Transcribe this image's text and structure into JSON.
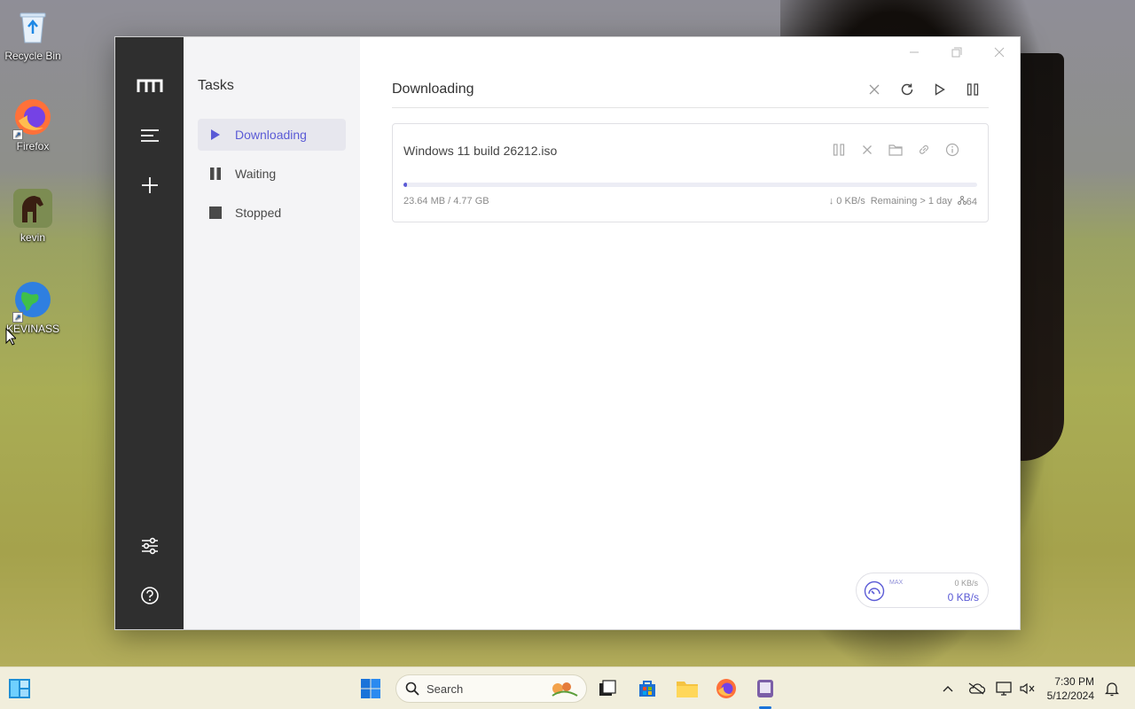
{
  "desktop": {
    "icons": [
      {
        "label": "Recycle Bin"
      },
      {
        "label": "Firefox"
      },
      {
        "label": "kevin"
      },
      {
        "label": "KEVINASS"
      }
    ]
  },
  "app": {
    "rail": {
      "logo_icon": "motrix-logo-icon",
      "menu_icon": "menu-icon",
      "add_icon": "plus-icon",
      "settings_icon": "sliders-icon",
      "help_icon": "help-circle-icon"
    },
    "sidebar": {
      "title": "Tasks",
      "items": [
        {
          "label": "Downloading",
          "icon": "play-icon",
          "active": true
        },
        {
          "label": "Waiting",
          "icon": "pause-icon",
          "active": false
        },
        {
          "label": "Stopped",
          "icon": "stop-icon",
          "active": false
        }
      ]
    },
    "main": {
      "title": "Downloading",
      "header_actions": [
        "close-icon",
        "refresh-icon",
        "play-icon",
        "pause-icon"
      ]
    },
    "task": {
      "name": "Windows 11 build 26212.iso",
      "progress": 0.005,
      "size": "23.64 MB / 4.77 GB",
      "speed": "↓ 0 KB/s",
      "remaining": "Remaining > 1 day",
      "connections": "64",
      "actions": [
        "pause-icon",
        "close-icon",
        "folder-icon",
        "link-icon",
        "info-icon"
      ]
    },
    "speed_widget": {
      "max_label": "MAX",
      "upload": "0 KB/s",
      "download": "0 KB/s"
    }
  },
  "taskbar": {
    "search_placeholder": "Search",
    "time": "7:30 PM",
    "date": "5/12/2024"
  },
  "colors": {
    "accent": "#5b5bd6",
    "rail": "#2f2f2f",
    "sidebar": "#f4f4f6"
  }
}
